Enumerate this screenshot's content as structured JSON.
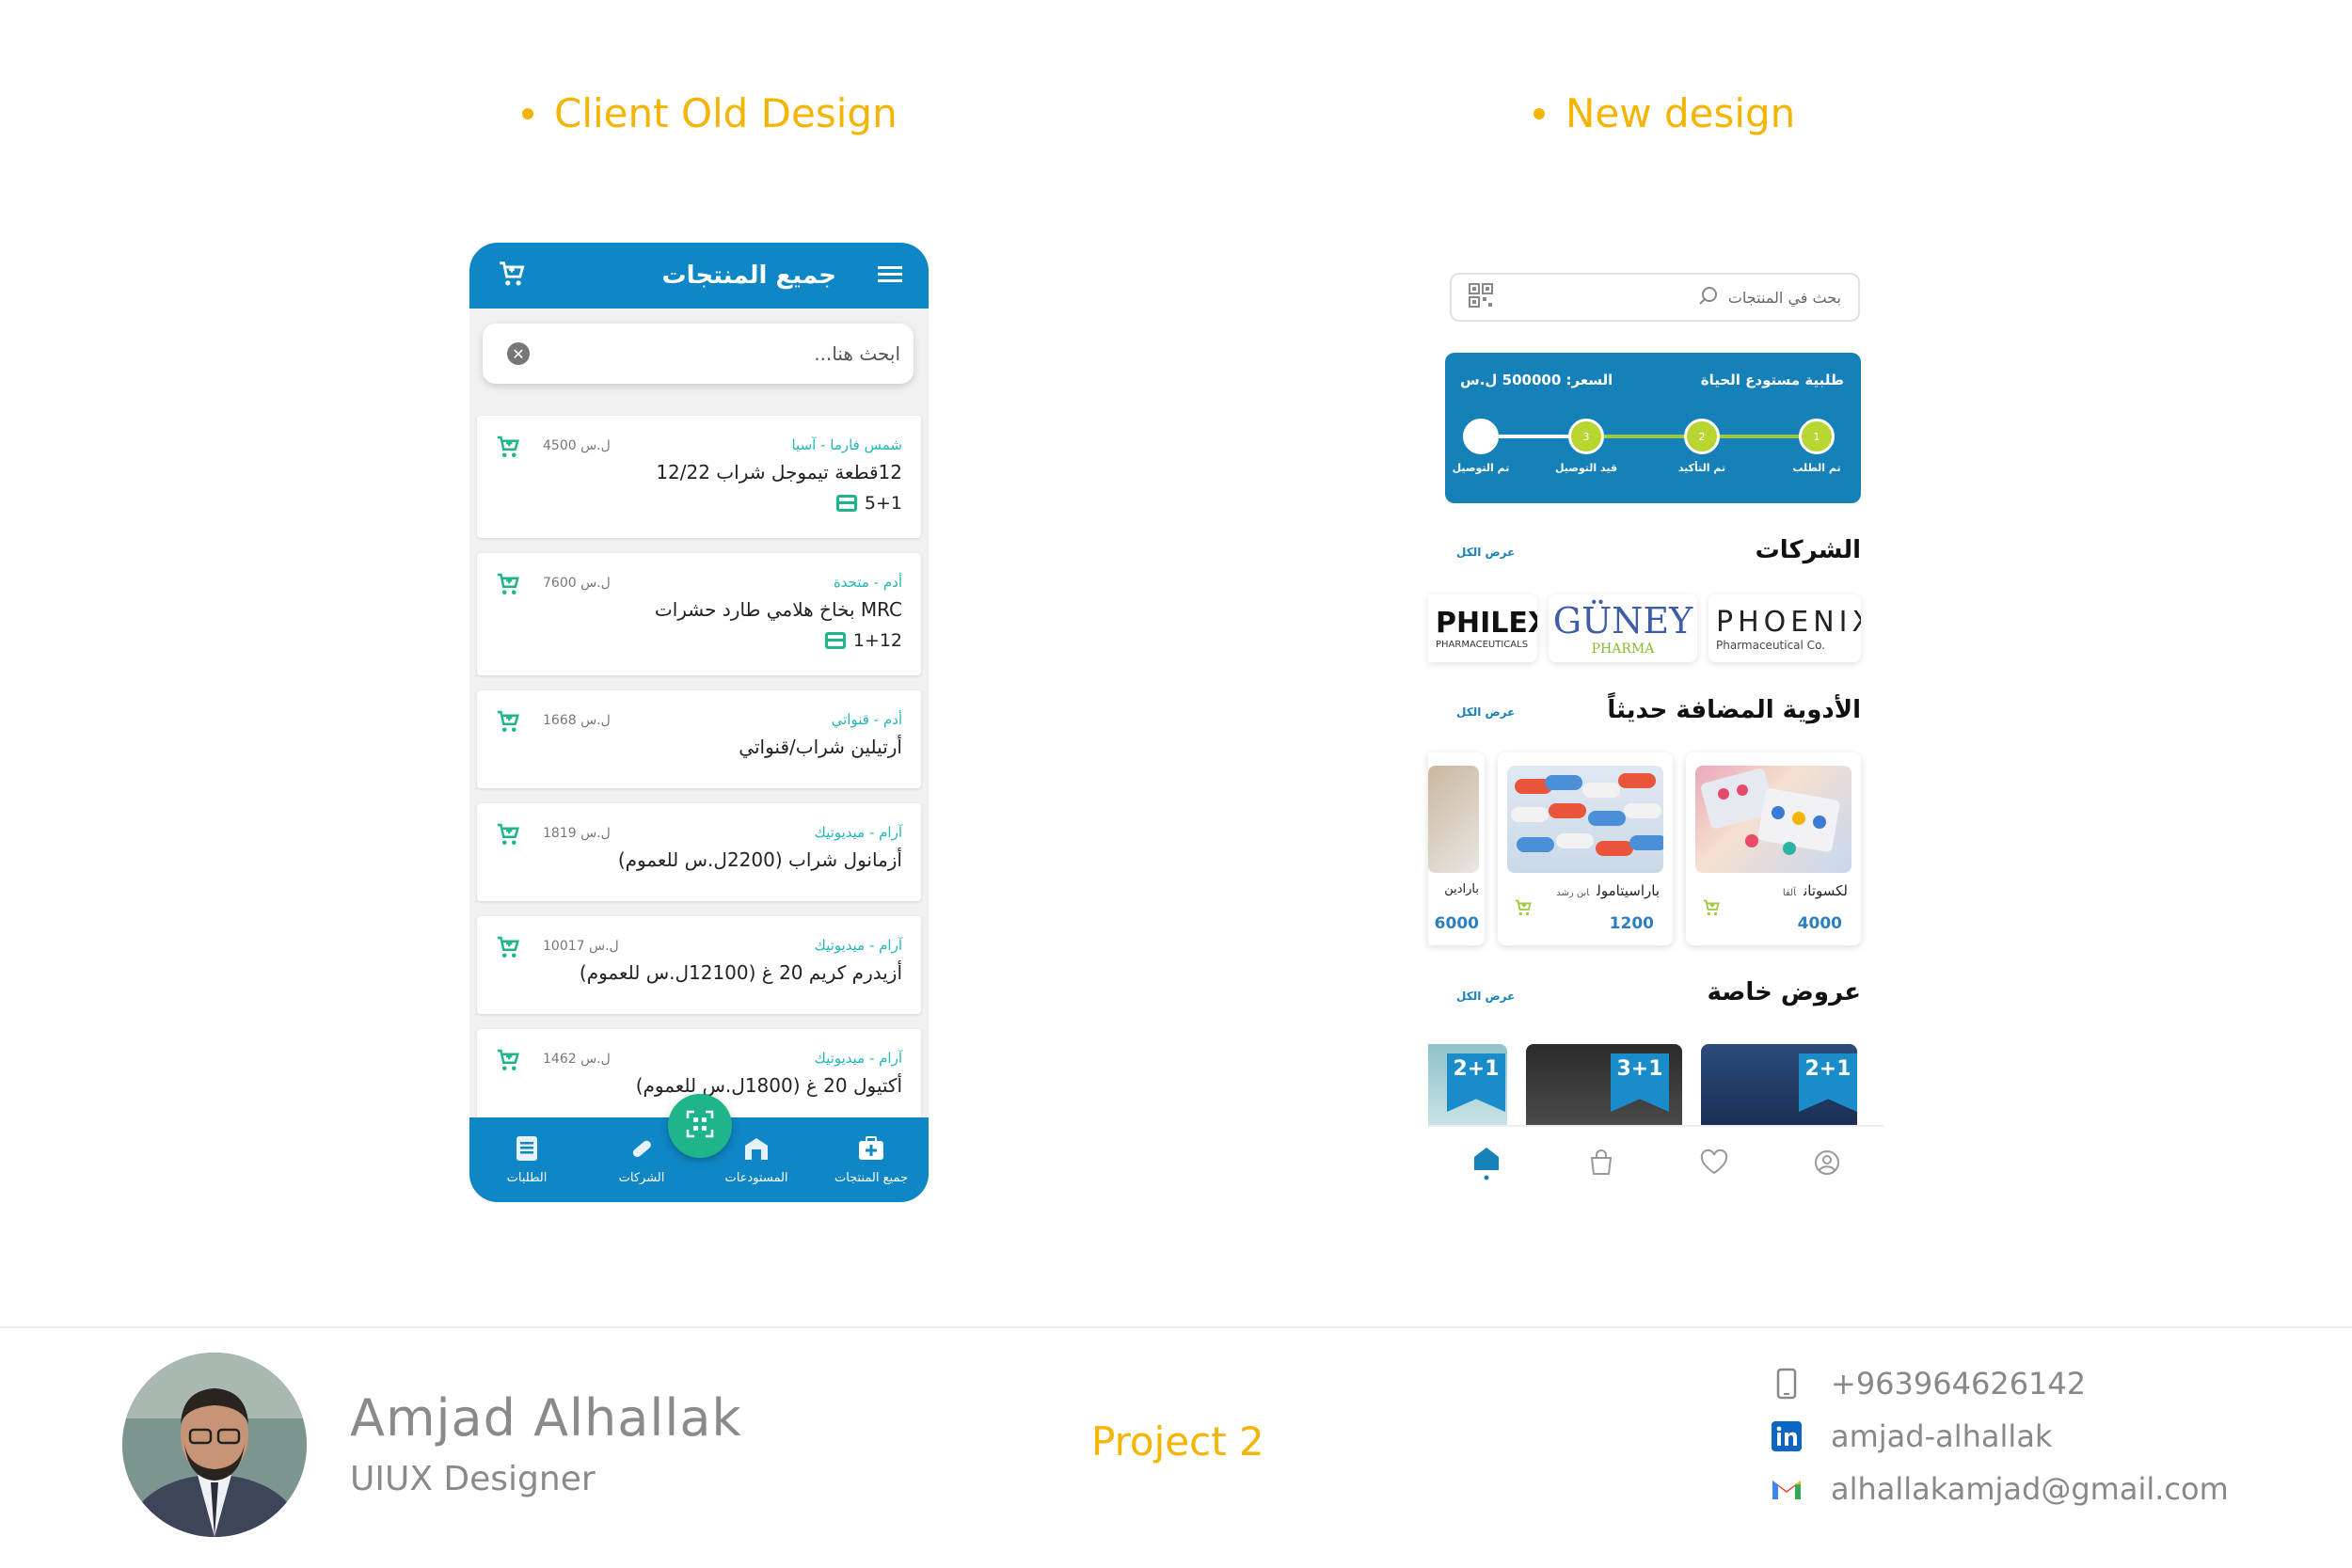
{
  "headings": {
    "old": "Client Old Design",
    "new": "New design"
  },
  "old_app": {
    "title": "جميع المنتجات",
    "search_placeholder": "ابحث هنا...",
    "products": [
      {
        "company": "شمس فارما - آسيا",
        "name": "12قطعة تيموجل شراب 12/22",
        "price": "4500 ل.س",
        "offer": "5+1"
      },
      {
        "company": "أدم - متحدة",
        "name": "MRC بخاخ هلامي طارد حشرات",
        "price": "7600 ل.س",
        "offer": "1+12"
      },
      {
        "company": "أدم - قنواتي",
        "name": "أرتيلين شراب/قنواتي",
        "price": "1668 ل.س",
        "offer": ""
      },
      {
        "company": "آرام - ميديوتيك",
        "name": "أزمانول شراب (2200ل.س للعموم)",
        "price": "1819 ل.س",
        "offer": ""
      },
      {
        "company": "آرام - ميديوتيك",
        "name": "أزيدرم كريم 20 غ (12100ل.س للعموم)",
        "price": "10017 ل.س",
        "offer": ""
      },
      {
        "company": "آرام - ميديوتيك",
        "name": "أكتيول 20 غ (1800ل.س للعموم)",
        "price": "1462 ل.س",
        "offer": ""
      }
    ],
    "nav": [
      {
        "label": "الطلبات",
        "icon": "orders-icon"
      },
      {
        "label": "الشركات",
        "icon": "pill-icon"
      },
      {
        "label": "المستودعات",
        "icon": "warehouse-icon"
      },
      {
        "label": "جميع المنتجات",
        "icon": "medkit-icon"
      }
    ]
  },
  "new_app": {
    "search_placeholder": "بحث في المنتجات",
    "order": {
      "title": "طلبية مستودع الحياة",
      "price": "السعر: 500000 ل.س",
      "steps": [
        {
          "label": "تم الطلب",
          "num": "1"
        },
        {
          "label": "تم التأكيد",
          "num": "2"
        },
        {
          "label": "قيد التوصيل",
          "num": "3"
        },
        {
          "label": "تم التوصيل",
          "num": ""
        }
      ]
    },
    "companies": {
      "title": "الشركات",
      "see_all": "عرض الكل",
      "logos": [
        {
          "main": "PHOENIX",
          "sub": "Pharmaceutical Co."
        },
        {
          "main": "GÜNEY",
          "sub": "PHARMA"
        },
        {
          "main": "PHILEX",
          "sub": "PHARMACEUTICALS"
        }
      ]
    },
    "new_meds": {
      "title": "الأدوية المضافة حديثاً",
      "see_all": "عرض الكل",
      "items": [
        {
          "name": "لكسوتان",
          "brand": "آلفا",
          "price": "4000"
        },
        {
          "name": "باراسيتامول",
          "brand": "ابن رشد",
          "price": "1200"
        },
        {
          "name": "بارادين",
          "brand": "",
          "price": "6000"
        }
      ]
    },
    "offers": {
      "title": "عروض خاصة",
      "see_all": "عرض الكل",
      "tags": [
        "2+1",
        "3+1",
        "2+1"
      ]
    },
    "nav": [
      "profile-icon",
      "heart-icon",
      "bag-icon",
      "home-icon"
    ]
  },
  "footer": {
    "name": "Amjad Alhallak",
    "role": "UIUX Designer",
    "project": "Project 2",
    "phone": "+963964626142",
    "linkedin": "amjad-alhallak",
    "email": "alhallakamjad@gmail.com"
  },
  "colors": {
    "accent": "#f4b400",
    "old_blue": "#0f86c5",
    "green": "#1fb58a",
    "new_blue": "#1680b8",
    "lime": "#b9d531"
  }
}
